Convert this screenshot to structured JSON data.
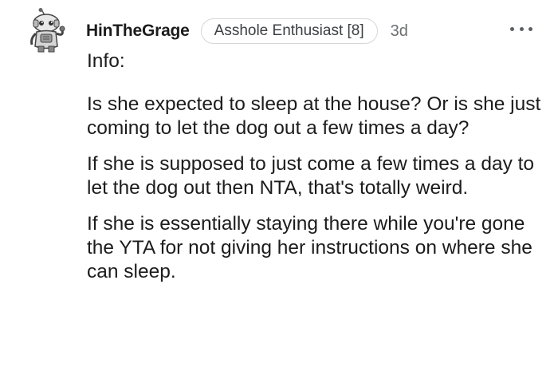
{
  "comment": {
    "username": "HinTheGrage",
    "flair": "Asshole Enthusiast [8]",
    "timestamp": "3d",
    "paragraphs": [
      "Info:",
      "Is she expected to sleep at the house? Or is she just coming to let the dog out a few times a day?",
      "If she is supposed to just come a few times a day to let the dog out then NTA, that's totally weird.",
      "If she is essentially staying there while you're gone the YTA for not giving her instructions on where she can sleep."
    ],
    "avatar_icon": "snoo-robot-avatar-icon",
    "menu_icon": "more-options-icon"
  }
}
